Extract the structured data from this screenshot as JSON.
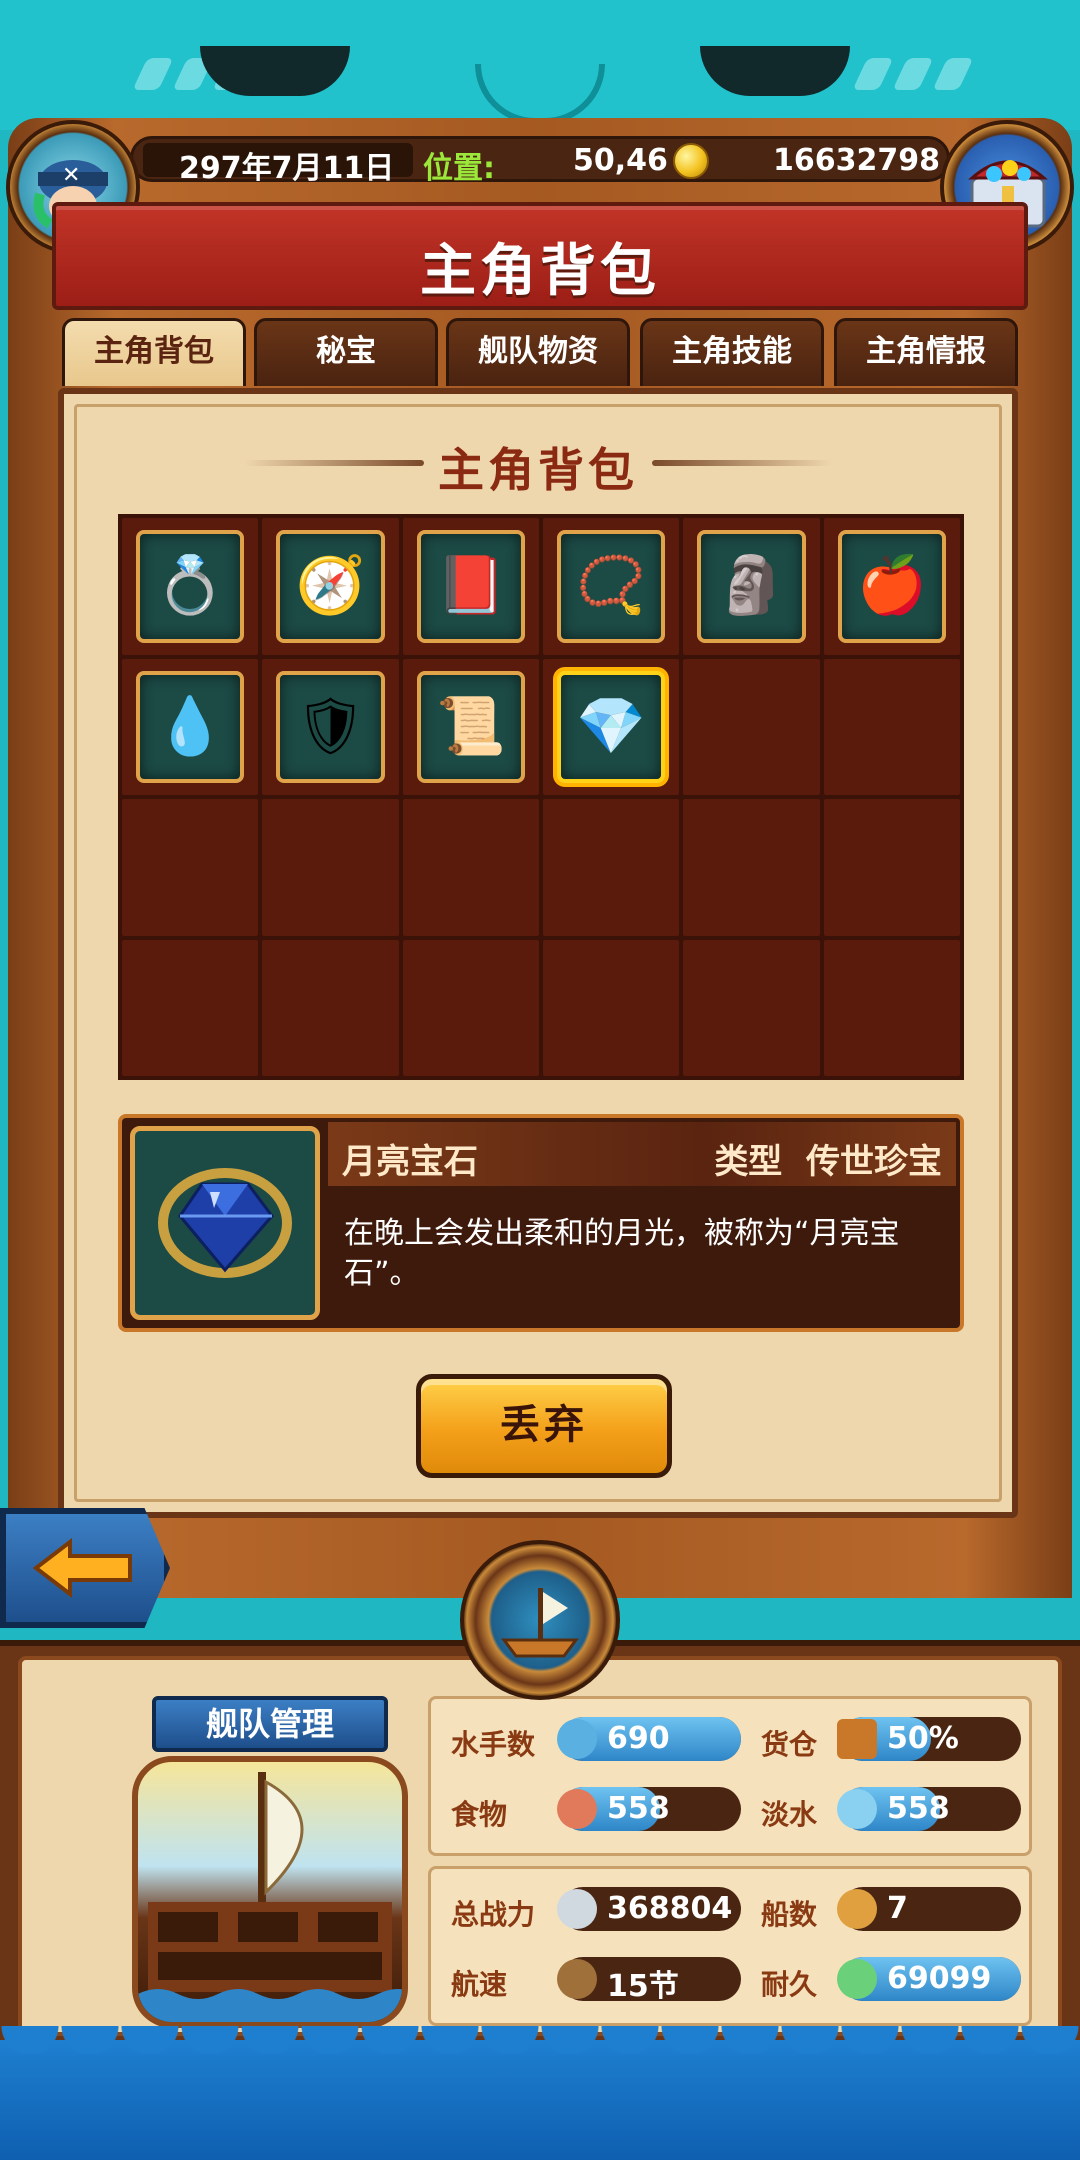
{
  "header": {
    "date": "297年7月11日",
    "location_label": "位置:",
    "coordinates": "50,46",
    "gold": "16632798"
  },
  "title": "主角背包",
  "tabs": [
    {
      "label": "主角背包",
      "active": true
    },
    {
      "label": "秘宝",
      "active": false
    },
    {
      "label": "舰队物资",
      "active": false
    },
    {
      "label": "主角技能",
      "active": false
    },
    {
      "label": "主角情报",
      "active": false
    }
  ],
  "panel_title": "主角背包",
  "inventory": {
    "columns": 6,
    "rows": 4,
    "items": [
      {
        "name": "ring-icon",
        "emoji": "💍"
      },
      {
        "name": "sextant-icon",
        "emoji": "🧭"
      },
      {
        "name": "book-icon",
        "emoji": "📕"
      },
      {
        "name": "bracelet-icon",
        "emoji": "📿"
      },
      {
        "name": "golden-statue-icon",
        "emoji": "🗿"
      },
      {
        "name": "golden-apple-icon",
        "emoji": "🍎"
      },
      {
        "name": "earrings-icon",
        "emoji": "💧"
      },
      {
        "name": "armor-icon",
        "emoji": "🛡"
      },
      {
        "name": "golden-scroll-icon",
        "emoji": "📜"
      },
      {
        "name": "moonstone-icon",
        "emoji": "💎",
        "selected": true
      }
    ]
  },
  "detail": {
    "name": "月亮宝石",
    "type_label": "类型",
    "type_value": "传世珍宝",
    "description": "在晚上会发出柔和的月光，被称为“月亮宝石”。"
  },
  "discard_button": "丢弃",
  "fleet": {
    "banner": "舰队管理",
    "stats_top": [
      {
        "label": "水手数",
        "value": "690",
        "fill": 1.0,
        "icon": "sailor-icon"
      },
      {
        "label": "货仓",
        "value": "50%",
        "fill": 0.5,
        "icon": "cargo-icon"
      },
      {
        "label": "食物",
        "value": "558",
        "fill": 0.55,
        "icon": "food-icon"
      },
      {
        "label": "淡水",
        "value": "558",
        "fill": 0.55,
        "icon": "water-icon"
      }
    ],
    "stats_bottom": [
      {
        "label": "总战力",
        "value": "368804",
        "icon": "sword-icon"
      },
      {
        "label": "船数",
        "value": "7",
        "icon": "ship-icon"
      },
      {
        "label": "航速",
        "value": "15节",
        "icon": "speed-icon"
      },
      {
        "label": "耐久",
        "value": "69099",
        "fill": 1.0,
        "icon": "durability-icon"
      }
    ]
  }
}
